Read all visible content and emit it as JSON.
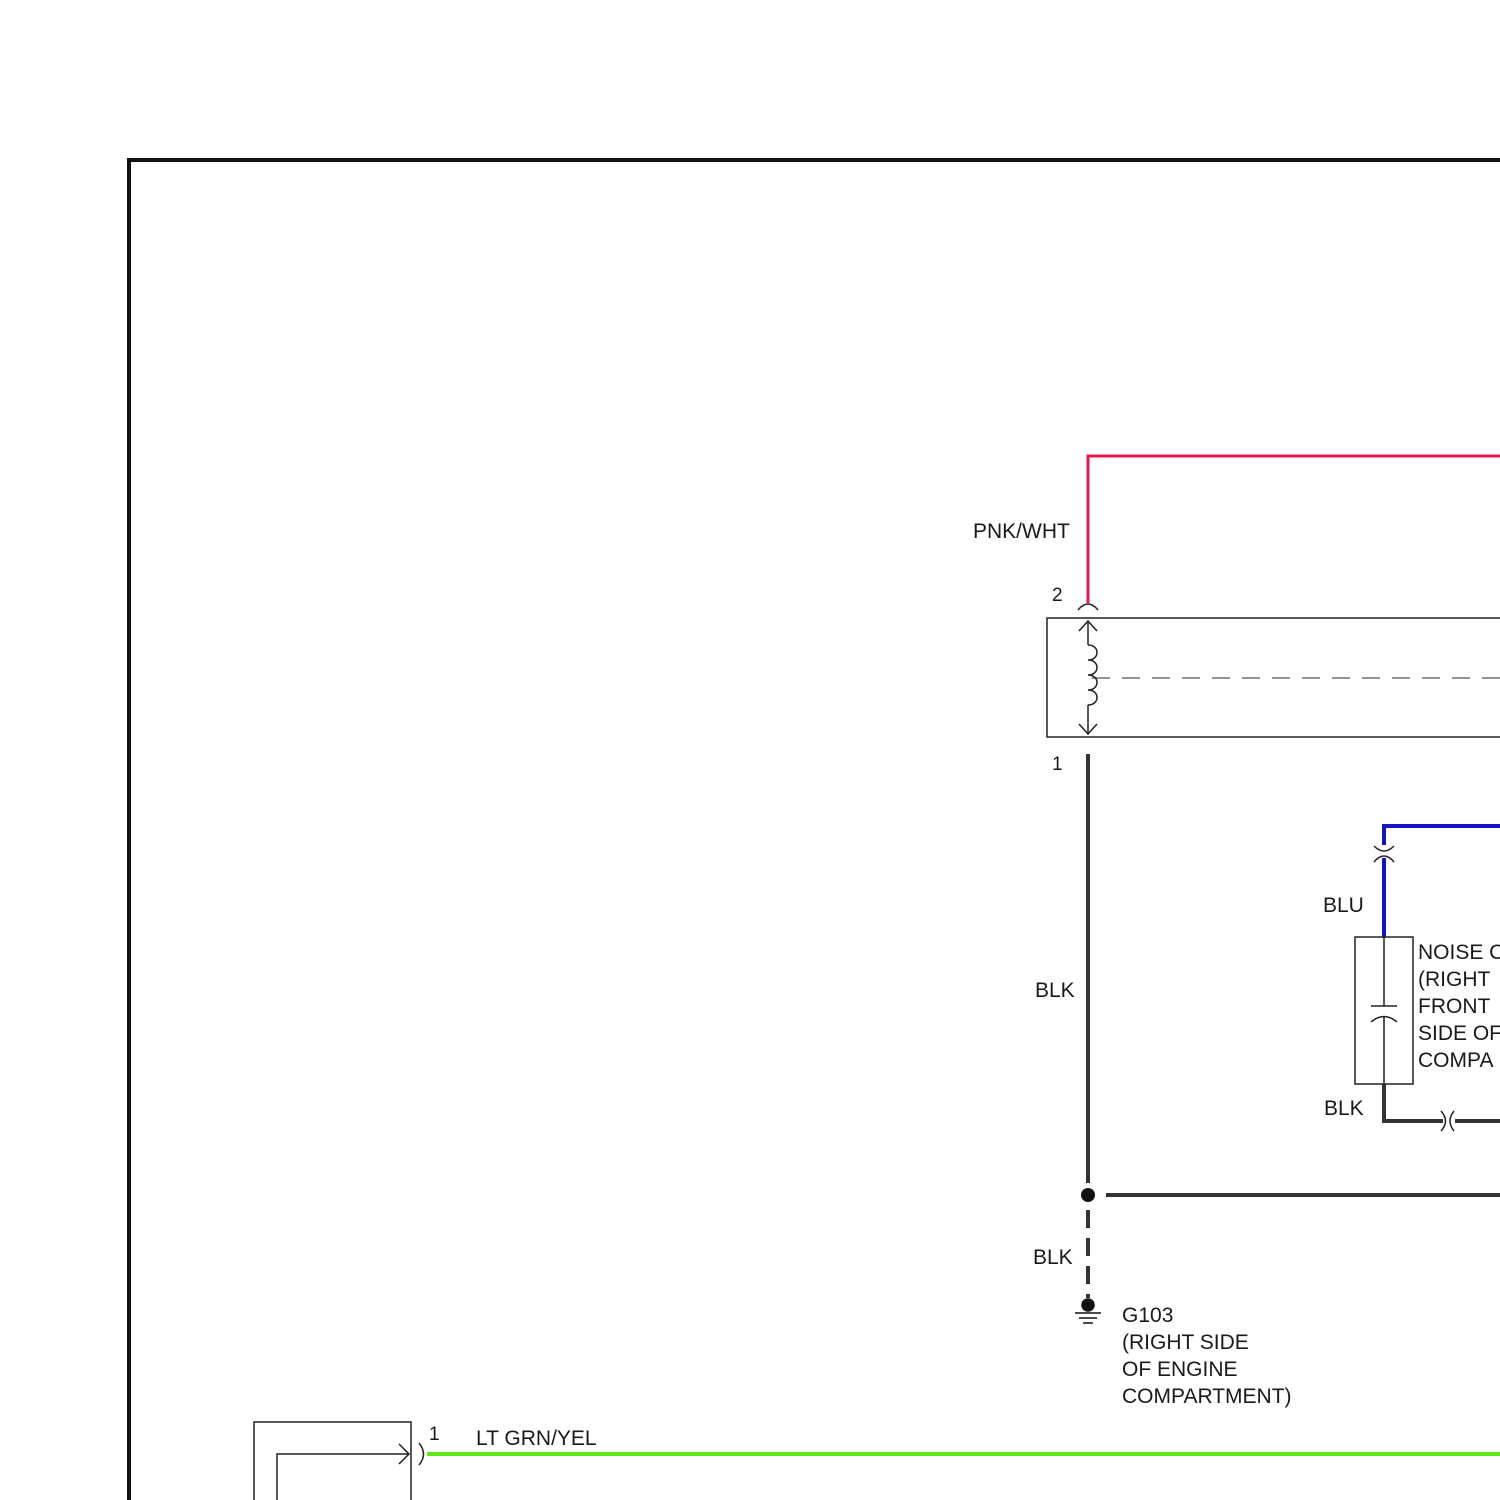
{
  "wires": {
    "pnk_wht": {
      "label": "PNK/WHT",
      "color": "#e8174f"
    },
    "blk_main": {
      "label": "BLK",
      "color": "#333333"
    },
    "blk_ground": {
      "label": "BLK"
    },
    "blu": {
      "label": "BLU",
      "color": "#1414c8"
    },
    "blk_condenser": {
      "label": "BLK"
    },
    "lt_grn_yel": {
      "label": "LT GRN/YEL",
      "color": "#5de81c"
    }
  },
  "pins": {
    "coil_top": "2",
    "coil_bottom": "1",
    "bottom_left": "1"
  },
  "noise_condenser": {
    "label_lines": [
      "NOISE C",
      "(RIGHT",
      "FRONT",
      "SIDE OF",
      "COMPA"
    ]
  },
  "ground": {
    "id": "G103",
    "location_lines": [
      "(RIGHT SIDE",
      "OF ENGINE",
      "COMPARTMENT)"
    ]
  },
  "colors": {
    "frame": "#111111",
    "component": "#222222",
    "dashed": "#555555"
  }
}
